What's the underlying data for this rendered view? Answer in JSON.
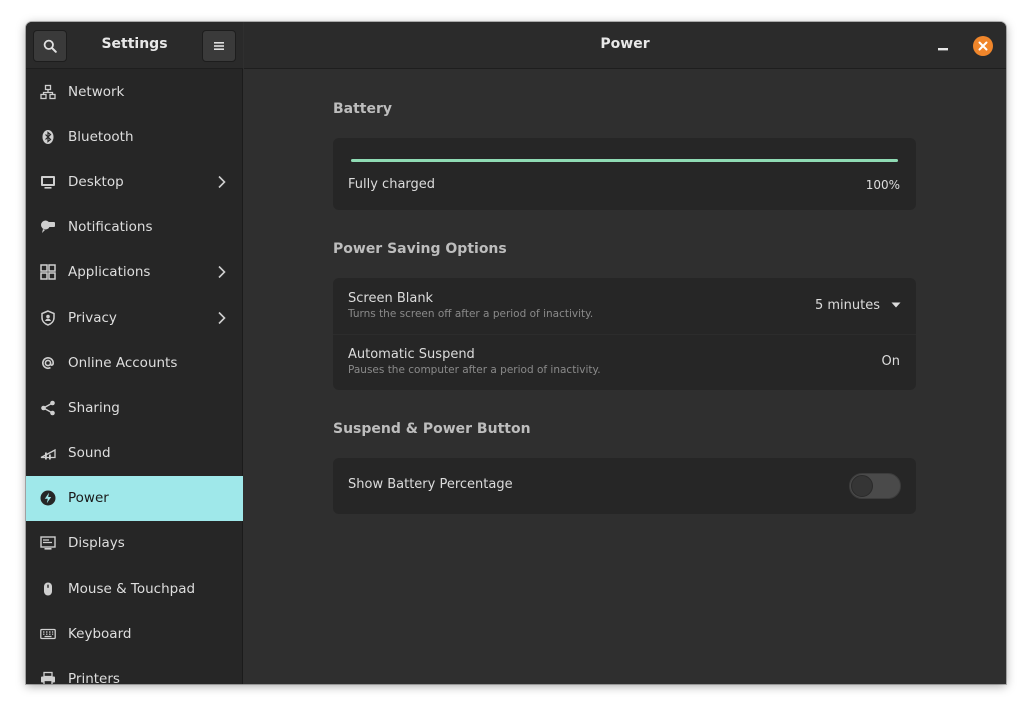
{
  "sidebar": {
    "title": "Settings",
    "search_icon": "search-icon",
    "menu_icon": "hamburger-menu-icon",
    "items": [
      {
        "label": "Network",
        "icon": "network-icon",
        "chevron": false
      },
      {
        "label": "Bluetooth",
        "icon": "bluetooth-icon",
        "chevron": false
      },
      {
        "label": "Desktop",
        "icon": "desktop-icon",
        "chevron": true
      },
      {
        "label": "Notifications",
        "icon": "notifications-icon",
        "chevron": false
      },
      {
        "label": "Applications",
        "icon": "applications-icon",
        "chevron": true
      },
      {
        "label": "Privacy",
        "icon": "privacy-icon",
        "chevron": true
      },
      {
        "label": "Online Accounts",
        "icon": "at-sign-icon",
        "chevron": false
      },
      {
        "label": "Sharing",
        "icon": "share-icon",
        "chevron": false
      },
      {
        "label": "Sound",
        "icon": "sound-icon",
        "chevron": false
      },
      {
        "label": "Power",
        "icon": "power-icon",
        "chevron": false,
        "active": true
      },
      {
        "label": "Displays",
        "icon": "display-icon",
        "chevron": false
      },
      {
        "label": "Mouse & Touchpad",
        "icon": "mouse-icon",
        "chevron": false
      },
      {
        "label": "Keyboard",
        "icon": "keyboard-icon",
        "chevron": false
      },
      {
        "label": "Printers",
        "icon": "printer-icon",
        "chevron": false
      }
    ]
  },
  "header": {
    "title": "Power"
  },
  "battery": {
    "section_title": "Battery",
    "status": "Fully charged",
    "percent_label": "100%",
    "level": 1.0
  },
  "power_saving": {
    "section_title": "Power Saving Options",
    "screen_blank": {
      "title": "Screen Blank",
      "subtitle": "Turns the screen off after a period of inactivity.",
      "value": "5 minutes"
    },
    "automatic_suspend": {
      "title": "Automatic Suspend",
      "subtitle": "Pauses the computer after a period of inactivity.",
      "value": "On"
    }
  },
  "suspend_power": {
    "section_title": "Suspend & Power Button",
    "show_battery_percentage": {
      "label": "Show Battery Percentage",
      "enabled": false
    }
  },
  "colors": {
    "accent": "#9fe8ea",
    "battery_bar": "#8fdbb4",
    "close_button": "#f0862b"
  }
}
